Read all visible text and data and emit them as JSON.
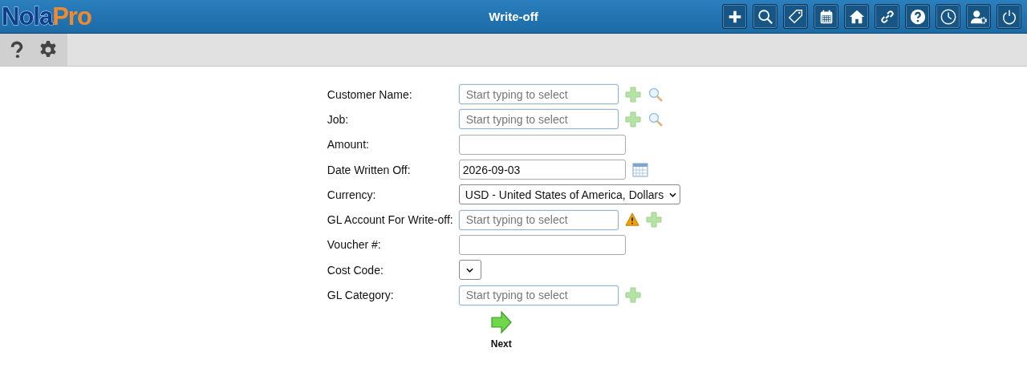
{
  "header": {
    "logo": {
      "first": "Nola",
      "second": "Pro"
    },
    "title": "Write-off"
  },
  "form": {
    "fields": [
      {
        "label": "Customer Name:",
        "kind": "search_autocomplete",
        "placeholder": "Start typing to select"
      },
      {
        "label": "Job:",
        "kind": "search_autocomplete",
        "placeholder": "Start typing to select"
      },
      {
        "label": "Amount:",
        "kind": "text"
      },
      {
        "label": "Date Written Off:",
        "kind": "date",
        "value": "2026-09-03"
      },
      {
        "label": "Currency:",
        "kind": "select",
        "value": "USD - United States of America, Dollars"
      },
      {
        "label": "GL Account For Write-off:",
        "kind": "autocomplete",
        "placeholder": "Start typing to select",
        "warning": true
      },
      {
        "label": "Voucher #:",
        "kind": "text"
      },
      {
        "label": "Cost Code:",
        "kind": "select"
      },
      {
        "label": "GL Category:",
        "kind": "autocomplete",
        "placeholder": "Start typing to select",
        "warning": false
      }
    ],
    "next_button": {
      "label": "Next"
    }
  }
}
